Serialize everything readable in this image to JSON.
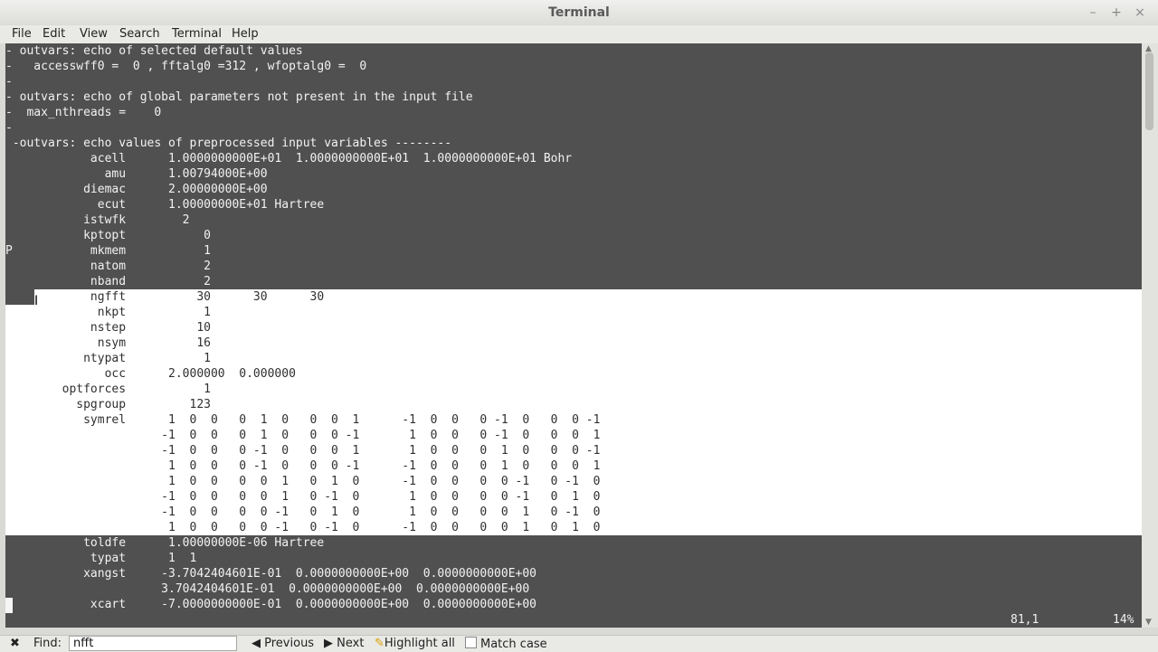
{
  "window": {
    "title": "Terminal",
    "minimize": "–",
    "maximize": "+",
    "close": "×"
  },
  "menu": [
    "File",
    "Edit",
    "View",
    "Search",
    "Terminal",
    "Help"
  ],
  "terminal": {
    "lines": [
      "- outvars: echo of selected default values",
      "-   accesswff0 =  0 , fftalg0 =312 , wfoptalg0 =  0",
      "-",
      "- outvars: echo of global parameters not present in the input file",
      "-  max_nthreads =    0",
      "-",
      " -outvars: echo values of preprocessed input variables --------",
      "            acell      1.0000000000E+01  1.0000000000E+01  1.0000000000E+01 Bohr",
      "              amu      1.00794000E+00",
      "           diemac      2.00000000E+00",
      "             ecut      1.00000000E+01 Hartree",
      "           istwfk        2",
      "           kptopt           0",
      "P           mkmem           1",
      "            natom           2",
      "            nband           2",
      "            ngfft          30      30      30",
      "             nkpt           1",
      "            nstep          10",
      "             nsym          16",
      "           ntypat           1",
      "              occ      2.000000  0.000000",
      "        optforces           1",
      "          spgroup         123",
      "           symrel      1  0  0   0  1  0   0  0  1      -1  0  0   0 -1  0   0  0 -1",
      "                      -1  0  0   0  1  0   0  0 -1       1  0  0   0 -1  0   0  0  1",
      "                      -1  0  0   0 -1  0   0  0  1       1  0  0   0  1  0   0  0 -1",
      "                       1  0  0   0 -1  0   0  0 -1      -1  0  0   0  1  0   0  0  1",
      "                       1  0  0   0  0  1   0  1  0      -1  0  0   0  0 -1   0 -1  0",
      "                      -1  0  0   0  0  1   0 -1  0       1  0  0   0  0 -1   0  1  0",
      "                      -1  0  0   0  0 -1   0  1  0       1  0  0   0  0  1   0 -1  0",
      "                       1  0  0   0  0 -1   0 -1  0      -1  0  0   0  0  1   0  1  0",
      "           toldfe      1.00000000E-06 Hartree",
      "            typat      1  1",
      "           xangst     -3.7042404601E-01  0.0000000000E+00  0.0000000000E+00",
      "                      3.7042404601E-01  0.0000000000E+00  0.0000000000E+00",
      "            xcart     -7.0000000000E-01  0.0000000000E+00  0.0000000000E+00"
    ],
    "status_position": "81,1",
    "status_percent": "14%"
  },
  "findbar": {
    "close_glyph": "✖",
    "label": "Find:",
    "value": "nfft",
    "previous": "Previous",
    "next": "Next",
    "highlight_all": "Highlight all",
    "match_case": "Match case"
  }
}
